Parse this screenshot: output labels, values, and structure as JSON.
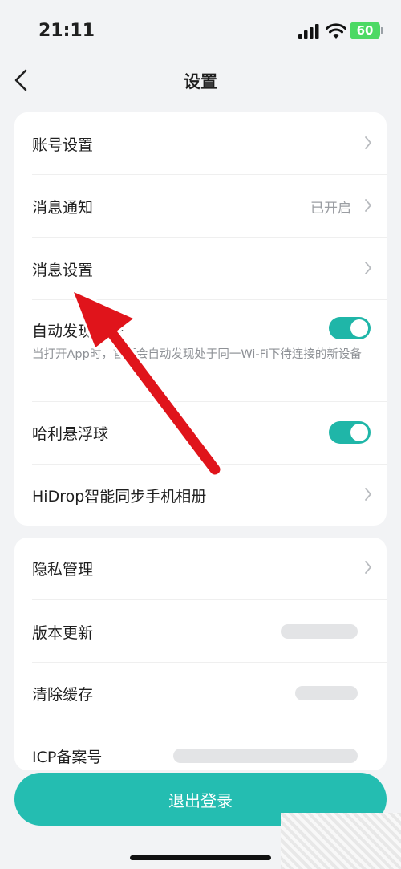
{
  "status_bar": {
    "time": "21:11",
    "battery": "60"
  },
  "nav": {
    "title": "设置"
  },
  "group1": {
    "account": {
      "label": "账号设置"
    },
    "notification": {
      "label": "消息通知",
      "value": "已开启"
    },
    "message_settings": {
      "label": "消息设置"
    },
    "auto_discover": {
      "label": "自动发现设备",
      "desc": "当打开App时，首页会自动发现处于同一Wi-Fi下待连接的新设备",
      "enabled": true
    },
    "float_ball": {
      "label": "哈利悬浮球",
      "enabled": true
    },
    "hidrop": {
      "label": "HiDrop智能同步手机相册"
    }
  },
  "group2": {
    "privacy": {
      "label": "隐私管理"
    },
    "version": {
      "label": "版本更新"
    },
    "cache": {
      "label": "清除缓存"
    },
    "icp": {
      "label": "ICP备案号"
    }
  },
  "logout": {
    "label": "退出登录"
  },
  "colors": {
    "accent": "#24bdb1",
    "arrow": "#e0141b"
  }
}
